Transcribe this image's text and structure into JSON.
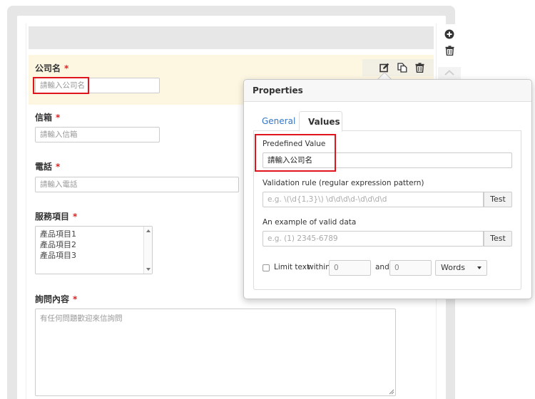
{
  "form": {
    "fields": [
      {
        "label": "公司名",
        "required": "*",
        "placeholder": "請輸入公司名"
      },
      {
        "label": "信箱",
        "required": "*",
        "placeholder": "請輸入信箱"
      },
      {
        "label": "電話",
        "required": "*",
        "placeholder": "請輸入電話"
      },
      {
        "label": "服務項目",
        "required": "*",
        "options": [
          "產品項目1",
          "產品項目2",
          "產品項目3"
        ]
      },
      {
        "label": "詢問內容",
        "required": "*",
        "placeholder": "有任何問題歡迎來信詢問"
      }
    ],
    "field_actions": [
      "edit-icon",
      "copy-icon",
      "trash-icon"
    ],
    "side_tools": [
      "plus-circle-icon",
      "trash-icon",
      "chevron-up-icon"
    ]
  },
  "properties": {
    "title": "Properties",
    "tabs": [
      {
        "label": "General",
        "active": false
      },
      {
        "label": "Values",
        "active": true
      }
    ],
    "predefined_label": "Predefined Value",
    "predefined_value": "請輸入公司名",
    "validation_label": "Validation rule (regular expression pattern)",
    "validation_placeholder": "e.g. \\(\\d{1,3}\\) \\d\\d\\d\\d-\\d\\d\\d\\d",
    "validation_button": "Test",
    "example_label": "An example of valid data",
    "example_placeholder": "e.g. (1) 2345-6789",
    "example_button": "Test",
    "limit_label": "Limit text",
    "within_label": "within",
    "min_value": "0",
    "and_label": "and",
    "max_value": "0",
    "unit_selected": "Words"
  },
  "colors": {
    "accent": "#3577c5",
    "required": "#e02020",
    "highlight": "#e0141c",
    "selected_row": "#fdf7e2"
  }
}
